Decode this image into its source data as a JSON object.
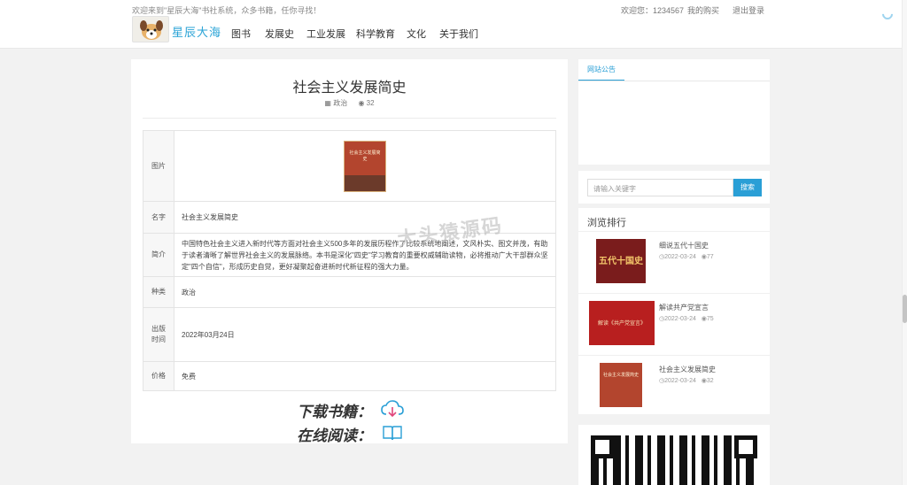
{
  "header": {
    "welcome": "欢迎来到\"星辰大海\"书社系统，众多书籍，任你寻找！",
    "greeting_user": "欢迎您：1234567",
    "my_purchases": "我的购买",
    "logout": "退出登录",
    "logo_text": "星辰大海"
  },
  "nav": [
    "图书",
    "发展史",
    "工业发展",
    "科学教育",
    "文化",
    "关于我们"
  ],
  "book": {
    "title": "社会主义发展简史",
    "category": "政治",
    "views": "32",
    "cover_title": "社会主义发展简史",
    "rows": {
      "image_label": "图片",
      "name_label": "名字",
      "name": "社会主义发展简史",
      "intro_label": "简介",
      "intro": "中国特色社会主义进入新时代等方面对社会主义500多年的发展历程作了比较系统地阐述，文风朴实、图文并茂，有助于读者清晰了解世界社会主义的发展脉络。本书是深化\"四史\"学习教育的重要权威辅助读物，必将推动广大干部群众坚定\"四个自信\"，形成历史自觉，更好凝聚起奋进新时代新征程的强大力量。",
      "category_label": "种类",
      "category": "政治",
      "date_label": "出版时间",
      "date": "2022年03月24日",
      "price_label": "价格",
      "price": "免费"
    },
    "download_label": "下载书籍：",
    "read_label": "在线阅读："
  },
  "watermark": "大头猿源码",
  "sidebar": {
    "notice_tab": "网站公告",
    "search_placeholder": "请输入关键字",
    "search_button": "搜索",
    "rank_title": "浏览排行",
    "rank_items": [
      {
        "name": "细说五代十国史",
        "date": "2022-03-24",
        "views": "77",
        "cover_text": "五代十国史"
      },
      {
        "name": "解读共产党宣言",
        "date": "2022-03-24",
        "views": "75",
        "cover_text": "解读《共产党宣言》"
      },
      {
        "name": "社会主义发展简史",
        "date": "2022-03-24",
        "views": "32",
        "cover_text": "社会主义发展简史"
      }
    ]
  },
  "colors": {
    "accent": "#2a9fd6",
    "background": "#f2f2f2"
  }
}
